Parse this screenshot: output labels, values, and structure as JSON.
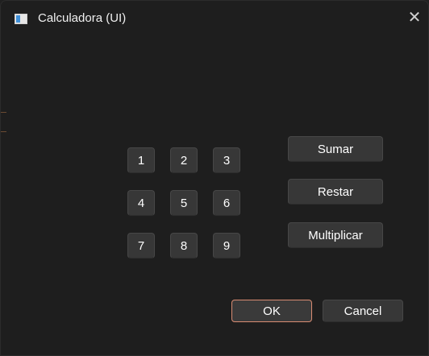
{
  "window": {
    "title": "Calculadora (UI)",
    "close_symbol": "✕"
  },
  "keypad": {
    "keys": [
      "1",
      "2",
      "3",
      "4",
      "5",
      "6",
      "7",
      "8",
      "9"
    ]
  },
  "operations": {
    "add_label": "Sumar",
    "subtract_label": "Restar",
    "multiply_label": "Multiplicar"
  },
  "dialog_buttons": {
    "ok_label": "OK",
    "cancel_label": "Cancel"
  },
  "colors": {
    "background": "#1e1e1e",
    "button": "#373737",
    "ok_focus_border": "#d98c72",
    "icon_accent": "#3f8fd8"
  }
}
